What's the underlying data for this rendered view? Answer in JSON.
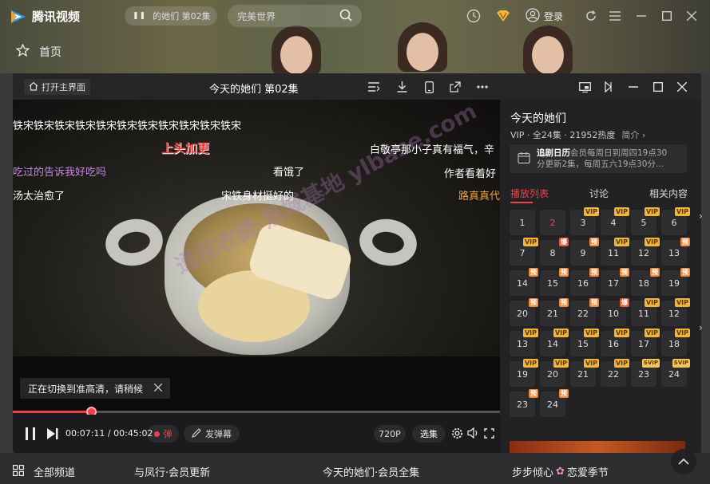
{
  "app": {
    "name": "腾讯视频",
    "accent": "#f0414a"
  },
  "header": {
    "mini_player_text": "的她们 第02集",
    "search_value": "完美世界",
    "login_label": "登录",
    "home_label": "首页"
  },
  "player": {
    "open_main_label": "打开主界面",
    "title": "今天的她们 第02集",
    "danmaku": [
      {
        "text": "铁宋铁宋铁宋铁宋铁宋铁宋铁宋铁宋铁宋铁宋铁宋",
        "color": "#ffffff"
      },
      {
        "text": "上头加更",
        "color": "#e83a3a"
      },
      {
        "text": "白敬亭那小子真有福气，辛",
        "color": "#ffffff"
      },
      {
        "text": "吃过的告诉我好吃吗",
        "color": "#c985e8"
      },
      {
        "text": "看饿了",
        "color": "#ffffff"
      },
      {
        "text": "作者看着好",
        "color": "#ffffff"
      },
      {
        "text": "汤太治愈了",
        "color": "#ffffff"
      },
      {
        "text": "宋铁身材挺好的",
        "color": "#ffffff"
      },
      {
        "text": "路真真代",
        "color": "#f0a040"
      }
    ],
    "watermark_text": "通视收藏·黑域基地",
    "watermark_text2": "ylbase.com",
    "toast": "正在切换到准高清，请稍候",
    "current_time": "00:07:11",
    "total_time": "00:45:02",
    "progress": 0.16,
    "danmaku_toggle_label": "弹",
    "send_danmaku_label": "发弹幕",
    "quality_label": "720P",
    "episodes_label": "选集"
  },
  "side": {
    "show_title": "今天的她们",
    "meta_vip": "VIP",
    "meta_episodes": "全24集",
    "meta_heat": "21952热度",
    "intro_label": "简介",
    "calendar_title": "追剧日历",
    "calendar_line1": "会员每周日到周四19点30",
    "calendar_line2": "分更新2集，每周五六19点30分...",
    "tabs": [
      "播放列表",
      "讨论",
      "相关内容"
    ],
    "episodes": [
      {
        "n": "1",
        "badge": ""
      },
      {
        "n": "2",
        "badge": "",
        "current": true
      },
      {
        "n": "3",
        "badge": "VIP"
      },
      {
        "n": "4",
        "badge": "VIP"
      },
      {
        "n": "5",
        "badge": "VIP"
      },
      {
        "n": "6",
        "badge": "VIP"
      },
      {
        "n": "7",
        "badge": "VIP"
      },
      {
        "n": "8",
        "badge": "爆"
      },
      {
        "n": "9",
        "badge": "预"
      },
      {
        "n": "11",
        "badge": "VIP"
      },
      {
        "n": "12",
        "badge": "VIP"
      },
      {
        "n": "13",
        "badge": "预"
      },
      {
        "n": "14",
        "badge": "预"
      },
      {
        "n": "15",
        "badge": "预"
      },
      {
        "n": "16",
        "badge": "预"
      },
      {
        "n": "17",
        "badge": "预"
      },
      {
        "n": "18",
        "badge": "预"
      },
      {
        "n": "19",
        "badge": "预"
      },
      {
        "n": "20",
        "badge": "预"
      },
      {
        "n": "21",
        "badge": "预"
      },
      {
        "n": "22",
        "badge": "预"
      },
      {
        "n": "10",
        "badge": "爆"
      },
      {
        "n": "11",
        "badge": "VIP"
      },
      {
        "n": "12",
        "badge": "VIP"
      },
      {
        "n": "13",
        "badge": "VIP"
      },
      {
        "n": "14",
        "badge": "VIP"
      },
      {
        "n": "15",
        "badge": "VIP"
      },
      {
        "n": "16",
        "badge": "VIP"
      },
      {
        "n": "17",
        "badge": "VIP"
      },
      {
        "n": "18",
        "badge": "VIP"
      },
      {
        "n": "19",
        "badge": "VIP"
      },
      {
        "n": "20",
        "badge": "VIP"
      },
      {
        "n": "21",
        "badge": "VIP"
      },
      {
        "n": "22",
        "badge": "VIP"
      },
      {
        "n": "23",
        "badge": "SVIP"
      },
      {
        "n": "24",
        "badge": "SVIP"
      },
      {
        "n": "23",
        "badge": "预"
      },
      {
        "n": "24",
        "badge": "预"
      }
    ]
  },
  "bottom": {
    "all_channels_label": "全部频道",
    "items": [
      "与凤行·会员更新",
      "今天的她们·会员全集",
      "步步倾心",
      "恋爱季节"
    ]
  }
}
